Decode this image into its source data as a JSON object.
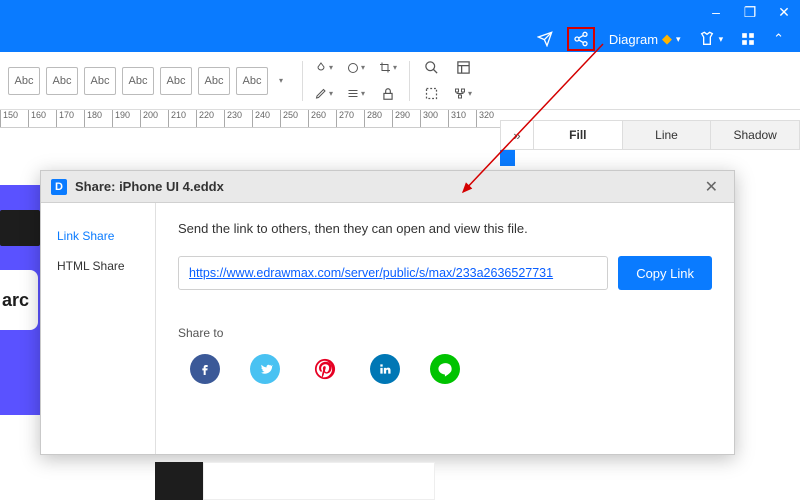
{
  "window": {
    "min": "–",
    "max": "❐",
    "close": "✕"
  },
  "menubar": {
    "send": "send-icon",
    "share": "share-icon",
    "diagram": "Diagram",
    "diamond": "◆",
    "shirt": "shirt-icon",
    "apps": "apps-icon",
    "chevron": "⌃"
  },
  "toolbar": {
    "abc": [
      "Abc",
      "Abc",
      "Abc",
      "Abc",
      "Abc",
      "Abc",
      "Abc"
    ],
    "icons_row1": [
      "paint-drop",
      "circle",
      "crop",
      "search",
      "layout"
    ],
    "icons_row2": [
      "pencil",
      "lines",
      "lock",
      "selection",
      "nodes"
    ]
  },
  "ruler": {
    "marks": [
      150,
      160,
      170,
      180,
      190,
      200,
      210,
      220,
      230,
      240,
      250,
      260,
      270,
      280,
      290,
      300,
      310,
      320
    ]
  },
  "side_panel": {
    "expand": "»",
    "tabs": [
      "Fill",
      "Line",
      "Shadow"
    ],
    "active": 0
  },
  "canvas": {
    "text_fragment": "arc"
  },
  "dialog": {
    "title": "Share: iPhone UI 4.eddx",
    "logo_letter": "D",
    "close": "✕",
    "sidebar": [
      {
        "label": "Link Share",
        "active": true
      },
      {
        "label": "HTML Share",
        "active": false
      }
    ],
    "message": "Send the link to others, then they can open and view this file.",
    "url": "https://www.edrawmax.com/server/public/s/max/233a2636527731",
    "copy_label": "Copy Link",
    "share_to": "Share to",
    "social": [
      {
        "name": "facebook",
        "glyph": "f",
        "cls": "fb"
      },
      {
        "name": "twitter",
        "glyph": "t",
        "cls": "tw"
      },
      {
        "name": "pinterest",
        "glyph": "␡",
        "cls": "pn"
      },
      {
        "name": "linkedin",
        "glyph": "in",
        "cls": "li"
      },
      {
        "name": "line",
        "glyph": "○",
        "cls": "ln"
      }
    ]
  }
}
